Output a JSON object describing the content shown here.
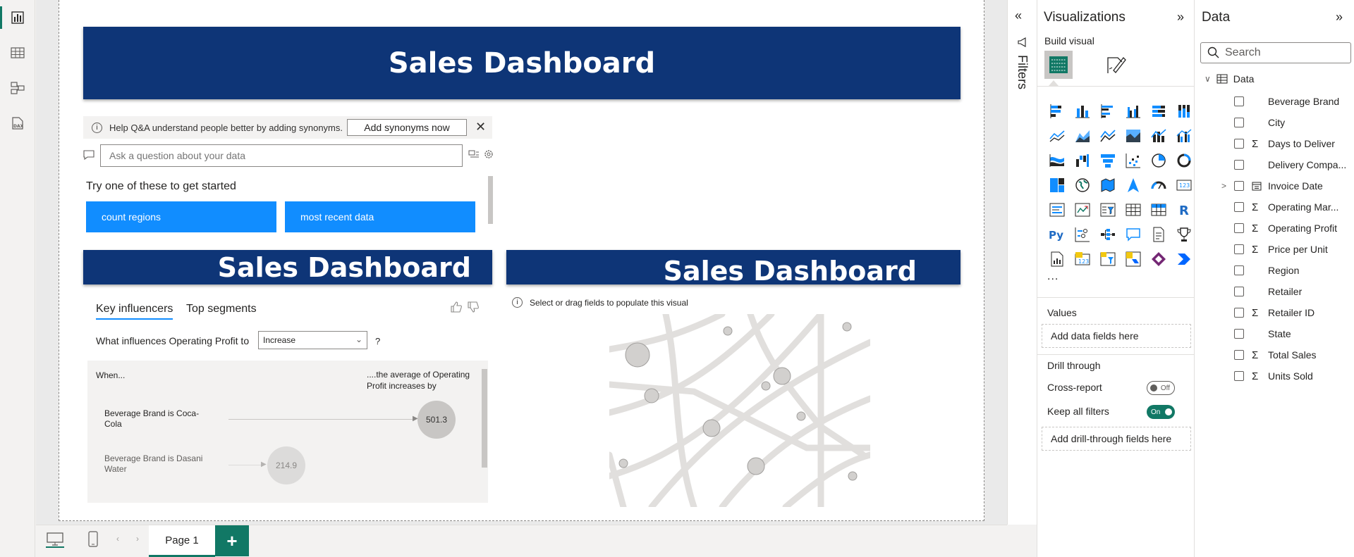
{
  "canvas": {
    "banner_title": "Sales Dashboard",
    "banner_title_2": "Sales Dashboard",
    "banner_title_3": "Sales Dashboard"
  },
  "qa": {
    "help_text": "Help Q&A understand people better by adding synonyms.",
    "add_synonyms": "Add synonyms now",
    "placeholder": "Ask a question about your data",
    "try_text": "Try one of these to get started",
    "suggestions": [
      "count regions",
      "most recent data"
    ]
  },
  "key_influencers": {
    "tabs": [
      "Key influencers",
      "Top segments"
    ],
    "question": "What influences Operating Profit to",
    "selected": "Increase",
    "question_mark": "?",
    "when": "When...",
    "avg_text": "....the average of Operating Profit increases by",
    "rows": [
      {
        "label": "Beverage Brand is Coca-Cola",
        "value": "501.3"
      },
      {
        "label": "Beverage Brand is Dasani Water",
        "value": "214.9"
      }
    ]
  },
  "map": {
    "info": "Select or drag fields to populate this visual"
  },
  "bottom": {
    "page_tab": "Page 1",
    "add_page": "+"
  },
  "filters": {
    "title": "Filters"
  },
  "visualizations": {
    "title": "Visualizations",
    "build_visual": "Build visual",
    "more": "...",
    "values_label": "Values",
    "values_well": "Add data fields here",
    "drill_label": "Drill through",
    "cross_report": "Cross-report",
    "cross_report_state": "Off",
    "keep_filters": "Keep all filters",
    "keep_filters_state": "On",
    "drill_well": "Add drill-through fields here"
  },
  "data": {
    "title": "Data",
    "search_placeholder": "Search",
    "table_name": "Data",
    "fields": [
      {
        "name": "Beverage Brand",
        "sigma": ""
      },
      {
        "name": "City",
        "sigma": ""
      },
      {
        "name": "Days to Deliver",
        "sigma": "Σ"
      },
      {
        "name": "Delivery Compa...",
        "sigma": ""
      },
      {
        "name": "Invoice Date",
        "sigma": "cal"
      },
      {
        "name": "Operating Mar...",
        "sigma": "Σ"
      },
      {
        "name": "Operating Profit",
        "sigma": "Σ"
      },
      {
        "name": "Price per Unit",
        "sigma": "Σ"
      },
      {
        "name": "Region",
        "sigma": ""
      },
      {
        "name": "Retailer",
        "sigma": ""
      },
      {
        "name": "Retailer ID",
        "sigma": "Σ"
      },
      {
        "name": "State",
        "sigma": ""
      },
      {
        "name": "Total Sales",
        "sigma": "Σ"
      },
      {
        "name": "Units Sold",
        "sigma": "Σ"
      }
    ]
  },
  "colors": {
    "banner": "#0e3577",
    "accent": "#117865",
    "qa_button": "#118dff"
  }
}
